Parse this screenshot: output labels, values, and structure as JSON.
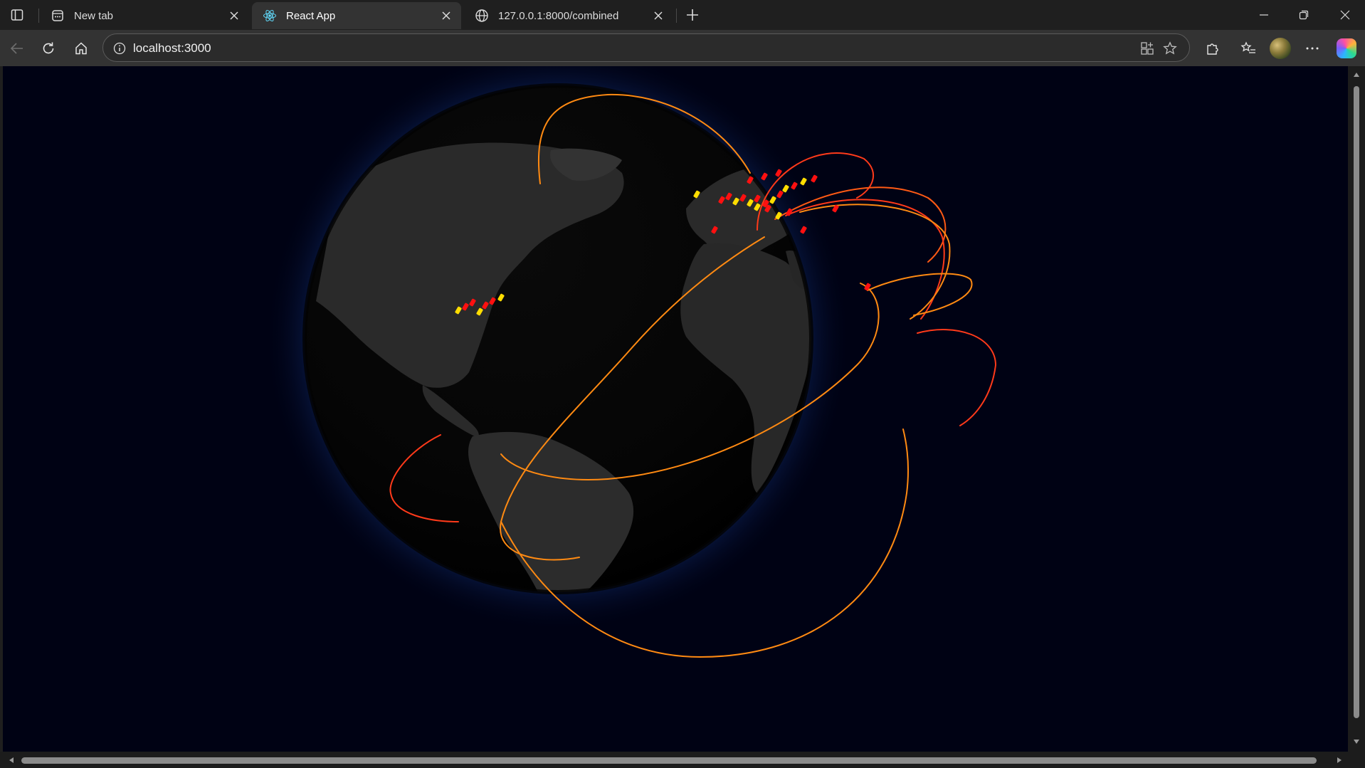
{
  "tabs": [
    {
      "title": "New tab",
      "icon": "newtab-page-icon"
    },
    {
      "title": "React App",
      "icon": "react-logo-icon",
      "active": true
    },
    {
      "title": "127.0.0.1:8000/combined",
      "icon": "globe-icon"
    }
  ],
  "address_bar": {
    "url": "localhost:3000"
  },
  "globe": {
    "description": "3D globe with attack arcs",
    "colors": {
      "arc_red": "#ff2a1a",
      "arc_orange": "#ff8a12",
      "marker_red": "#ff1010",
      "marker_yellow": "#ffdd00",
      "atmosphere": "#1c54c8",
      "background": "#000214"
    }
  }
}
